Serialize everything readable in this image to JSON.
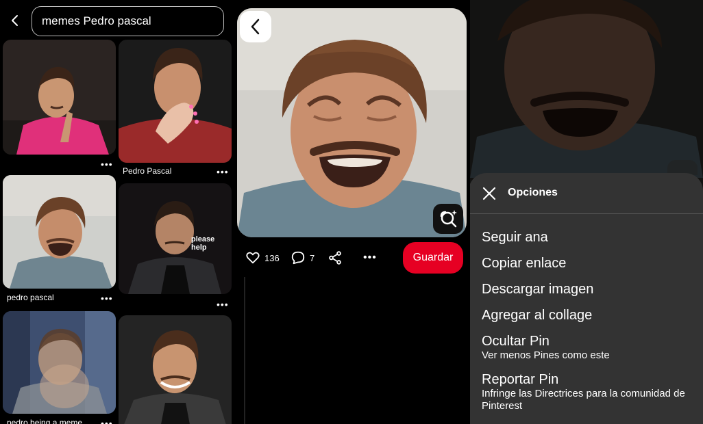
{
  "search": {
    "query": "memes Pedro pascal"
  },
  "results": {
    "items": [
      {
        "label": ""
      },
      {
        "label": "Pedro Pascal"
      },
      {
        "label": "pedro pascal"
      },
      {
        "label": "",
        "overlay": "please help"
      },
      {
        "label": "pedro being a meme"
      },
      {
        "label": ""
      }
    ],
    "more_glyph": "•••"
  },
  "pin": {
    "likes": "136",
    "comments": "7",
    "save_label": "Guardar",
    "more_glyph": "•••"
  },
  "options_sheet": {
    "title": "Opciones",
    "items": [
      {
        "label": "Seguir ana",
        "sub": ""
      },
      {
        "label": "Copiar enlace",
        "sub": ""
      },
      {
        "label": "Descargar imagen",
        "sub": ""
      },
      {
        "label": "Agregar al collage",
        "sub": ""
      },
      {
        "label": "Ocultar Pin",
        "sub": "Ver menos Pines como este"
      },
      {
        "label": "Reportar Pin",
        "sub": "Infringe las Directrices para la comunidad de Pinterest"
      }
    ]
  },
  "colors": {
    "save_button": "#e60023",
    "sheet_background": "#333333",
    "background": "#000000"
  },
  "icons": {
    "back": "chevron-left-icon",
    "heart": "heart-icon",
    "comment": "comment-icon",
    "share": "share-icon",
    "lens": "visual-search-icon",
    "close": "close-icon"
  }
}
